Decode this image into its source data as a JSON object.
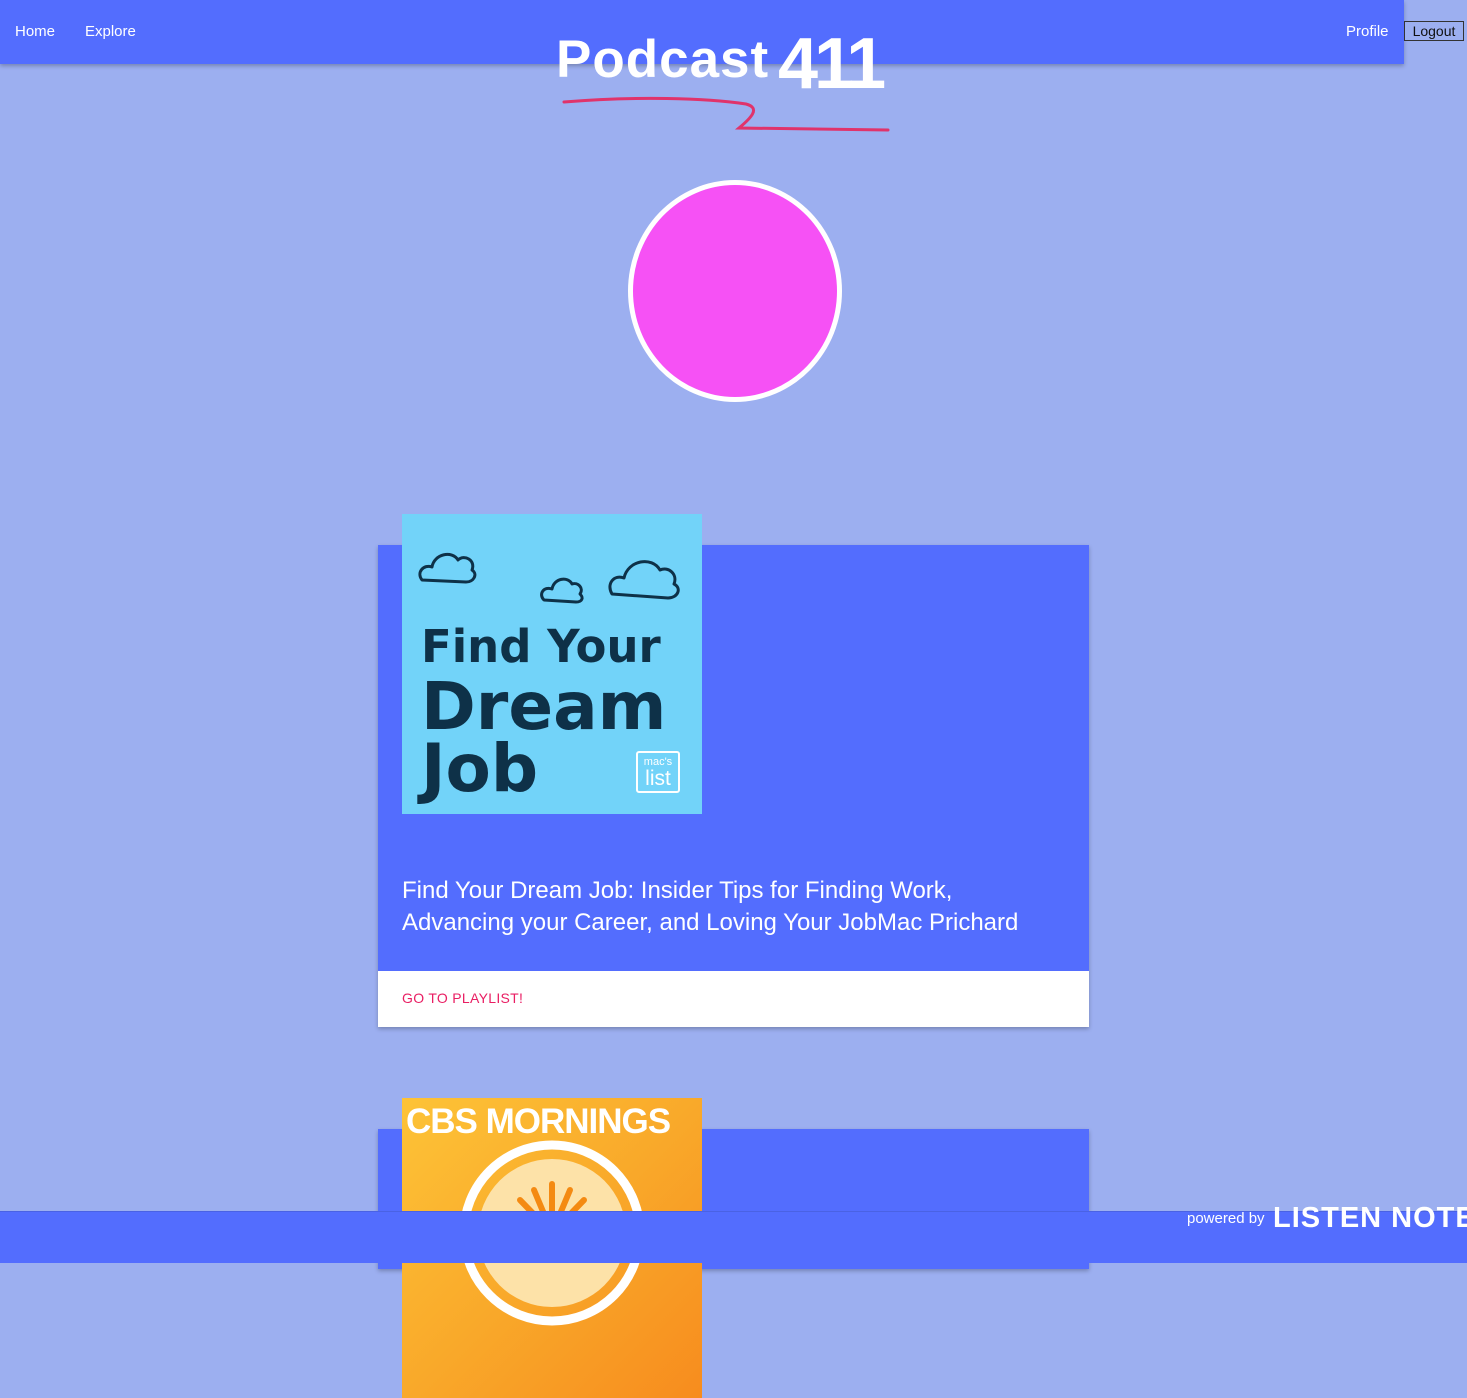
{
  "nav": {
    "home": "Home",
    "explore": "Explore",
    "profile": "Profile",
    "logout": "Logout"
  },
  "logo": {
    "word": "Podcast",
    "number": "411",
    "squiggle_color": "#e0336b"
  },
  "colors": {
    "page_bg": "#9caff0",
    "bar": "#536dfe",
    "avatar": "#f651f5",
    "link_accent": "#e91e63"
  },
  "cards": [
    {
      "cover": {
        "line1": "Find Your",
        "line2": "Dream",
        "line3": "Job",
        "badge_top": "mac's",
        "badge_bottom": "list"
      },
      "title": "Find Your Dream Job: Insider Tips for Finding Work, Advancing your Career, and Loving Your JobMac Prichard",
      "action": "GO TO PLAYLIST!"
    },
    {
      "cover": {
        "brand": "CBS MORNINGS"
      }
    }
  ],
  "footer": {
    "powered_by": "powered by",
    "brand": "LISTEN NOTES"
  }
}
